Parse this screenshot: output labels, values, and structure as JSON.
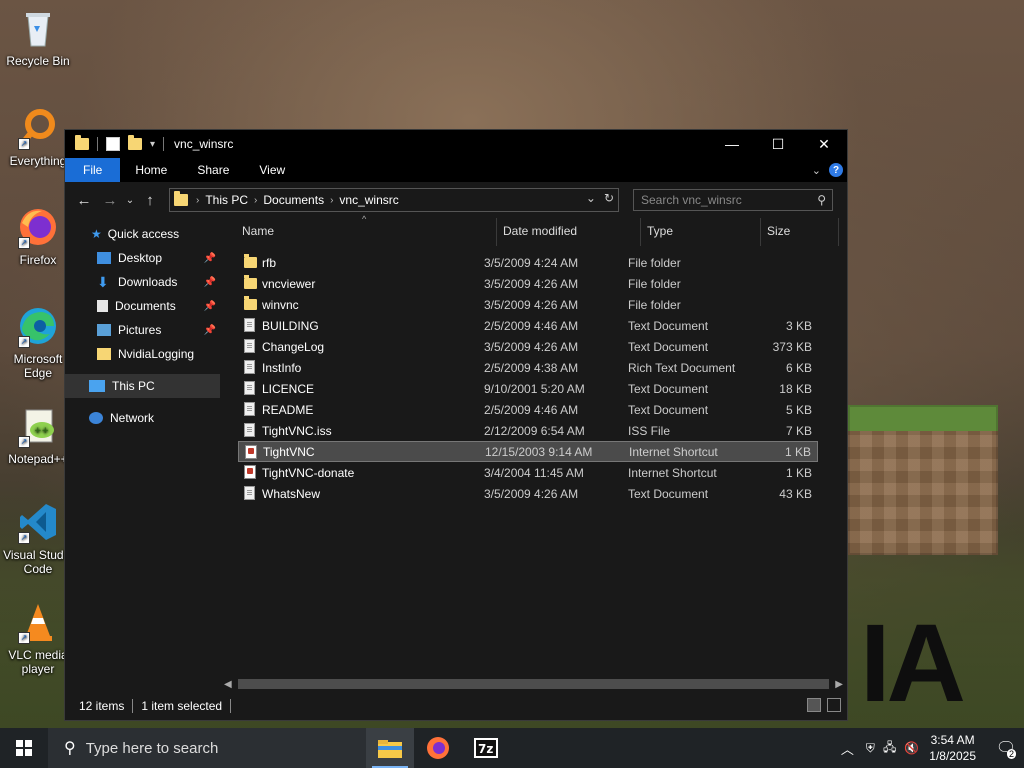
{
  "desktop": {
    "icons": [
      {
        "label": "Recycle Bin"
      },
      {
        "label": "Everything"
      },
      {
        "label": "Firefox"
      },
      {
        "label": "Microsoft Edge"
      },
      {
        "label": "Notepad++"
      },
      {
        "label": "Visual Studio Code"
      },
      {
        "label": "VLC media player"
      }
    ]
  },
  "window": {
    "title": "vnc_winsrc",
    "ribbon_tabs": [
      "File",
      "Home",
      "Share",
      "View"
    ],
    "breadcrumb": [
      "This PC",
      "Documents",
      "vnc_winsrc"
    ],
    "search_placeholder": "Search vnc_winsrc",
    "nav": {
      "quick_access": "Quick access",
      "items": [
        "Desktop",
        "Downloads",
        "Documents",
        "Pictures",
        "NvidiaLogging"
      ],
      "this_pc": "This PC",
      "network": "Network"
    },
    "columns": [
      "Name",
      "Date modified",
      "Type",
      "Size"
    ],
    "files": [
      {
        "name": "rfb",
        "date": "3/5/2009 4:24 AM",
        "type": "File folder",
        "size": "",
        "icon": "folder-icon"
      },
      {
        "name": "vncviewer",
        "date": "3/5/2009 4:26 AM",
        "type": "File folder",
        "size": "",
        "icon": "folder-icon"
      },
      {
        "name": "winvnc",
        "date": "3/5/2009 4:26 AM",
        "type": "File folder",
        "size": "",
        "icon": "folder-icon"
      },
      {
        "name": "BUILDING",
        "date": "2/5/2009 4:46 AM",
        "type": "Text Document",
        "size": "3 KB",
        "icon": "document-icon"
      },
      {
        "name": "ChangeLog",
        "date": "3/5/2009 4:26 AM",
        "type": "Text Document",
        "size": "373 KB",
        "icon": "document-icon"
      },
      {
        "name": "InstInfo",
        "date": "2/5/2009 4:38 AM",
        "type": "Rich Text Document",
        "size": "6 KB",
        "icon": "document-icon"
      },
      {
        "name": "LICENCE",
        "date": "9/10/2001 5:20 AM",
        "type": "Text Document",
        "size": "18 KB",
        "icon": "document-icon"
      },
      {
        "name": "README",
        "date": "2/5/2009 4:46 AM",
        "type": "Text Document",
        "size": "5 KB",
        "icon": "document-icon"
      },
      {
        "name": "TightVNC.iss",
        "date": "2/12/2009 6:54 AM",
        "type": "ISS File",
        "size": "7 KB",
        "icon": "document-icon"
      },
      {
        "name": "TightVNC",
        "date": "12/15/2003 9:14 AM",
        "type": "Internet Shortcut",
        "size": "1 KB",
        "icon": "shortcut-icon",
        "selected": true
      },
      {
        "name": "TightVNC-donate",
        "date": "3/4/2004 11:45 AM",
        "type": "Internet Shortcut",
        "size": "1 KB",
        "icon": "shortcut-icon"
      },
      {
        "name": "WhatsNew",
        "date": "3/5/2009 4:26 AM",
        "type": "Text Document",
        "size": "43 KB",
        "icon": "document-icon"
      }
    ],
    "status": {
      "items": "12 items",
      "selected": "1 item selected"
    }
  },
  "taskbar": {
    "search_placeholder": "Type here to search",
    "clock_time": "3:54 AM",
    "clock_date": "1/8/2025",
    "notifications": "2"
  },
  "wallpaper_text": "IA"
}
